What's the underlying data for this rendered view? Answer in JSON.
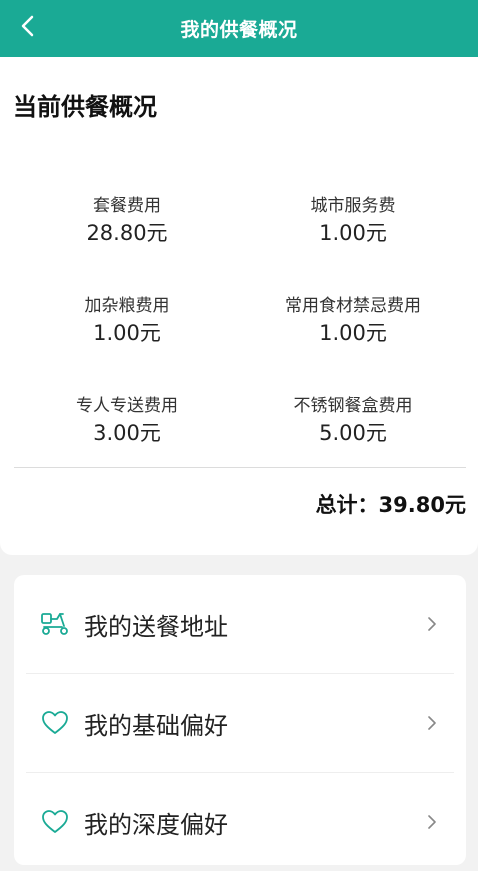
{
  "header": {
    "title": "我的供餐概况",
    "back_icon": "chevron-left-icon",
    "background": "#1aaa95"
  },
  "summary": {
    "title": "当前供餐概况",
    "fees": [
      {
        "label": "套餐费用",
        "value": "28.80元"
      },
      {
        "label": "城市服务费",
        "value": "1.00元"
      },
      {
        "label": "加杂粮费用",
        "value": "1.00元"
      },
      {
        "label": "常用食材禁忌费用",
        "value": "1.00元"
      },
      {
        "label": "专人专送费用",
        "value": "3.00元"
      },
      {
        "label": "不锈钢餐盒费用",
        "value": "5.00元"
      }
    ],
    "total": "总计：39.80元"
  },
  "menu": {
    "items": [
      {
        "label": "我的送餐地址",
        "icon": "delivery-scooter-icon"
      },
      {
        "label": "我的基础偏好",
        "icon": "heart-icon"
      },
      {
        "label": "我的深度偏好",
        "icon": "heart-icon"
      }
    ],
    "accent": "#1aaa95"
  }
}
